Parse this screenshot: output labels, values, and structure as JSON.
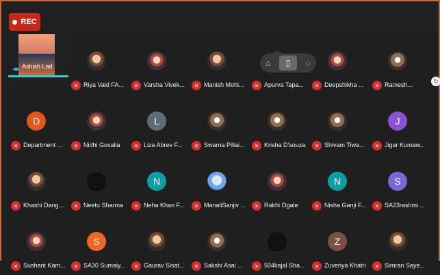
{
  "recording": {
    "label": "REC"
  },
  "participants": [
    {
      "name": "Ashish Lad",
      "avatar": "",
      "type": "video",
      "color": "#2c2c2c"
    },
    {
      "name": "Riya Vaid FA...",
      "avatar": "",
      "type": "photo",
      "color": "#8a6b55"
    },
    {
      "name": "Varsha Vivek...",
      "avatar": "",
      "type": "photo2",
      "color": "#9a4a4a"
    },
    {
      "name": "Manish Mohi...",
      "avatar": "",
      "type": "photo",
      "color": "#6c7a8a"
    },
    {
      "name": "Apurva Tapa...",
      "avatar": "",
      "type": "photo3",
      "color": "#777"
    },
    {
      "name": "Deepshikha ...",
      "avatar": "",
      "type": "photo2",
      "color": "#9b5a3c"
    },
    {
      "name": "Ramesh...",
      "avatar": "",
      "type": "photo3",
      "color": "#777"
    },
    {
      "name": "Department ...",
      "avatar": "D",
      "type": "letter",
      "color": "#e0581f"
    },
    {
      "name": "Nidhi Gosalia",
      "avatar": "",
      "type": "photo2",
      "color": "#a34545"
    },
    {
      "name": "Liza Abrev F...",
      "avatar": "L",
      "type": "letter",
      "color": "#5b6d78"
    },
    {
      "name": "Swarna Pillai...",
      "avatar": "",
      "type": "photo3",
      "color": "#777"
    },
    {
      "name": "Krisha D'souza",
      "avatar": "",
      "type": "photo3",
      "color": "#777"
    },
    {
      "name": "Shivam Tiwa...",
      "avatar": "",
      "type": "photo3",
      "color": "#777"
    },
    {
      "name": "Jigar Kumaw...",
      "avatar": "J",
      "type": "letter",
      "color": "#8b52d6"
    },
    {
      "name": "Khashi Dang...",
      "avatar": "",
      "type": "photo",
      "color": "#8a6b55"
    },
    {
      "name": "Neetu Sharma",
      "avatar": "",
      "type": "photo5",
      "color": "#111"
    },
    {
      "name": "Neha Khan F...",
      "avatar": "N",
      "type": "letter",
      "color": "#0f9ea5"
    },
    {
      "name": "ManaliSanjiv ...",
      "avatar": "",
      "type": "photo4",
      "color": "#4c7fd1"
    },
    {
      "name": "Rakhi Ogale",
      "avatar": "",
      "type": "photo2",
      "color": "#7c4a5a"
    },
    {
      "name": "Nisha Ganji F...",
      "avatar": "N",
      "type": "letter",
      "color": "#0f9ea5"
    },
    {
      "name": "SA23rashmi ...",
      "avatar": "S",
      "type": "letter",
      "color": "#7b67d8"
    },
    {
      "name": "Sushant Kam...",
      "avatar": "",
      "type": "photo2",
      "color": "#a33"
    },
    {
      "name": "SA30 Sumaiy...",
      "avatar": "S",
      "type": "letter",
      "color": "#f06724"
    },
    {
      "name": "Gaurav Sisat...",
      "avatar": "",
      "type": "photo",
      "color": "#2f3a2f"
    },
    {
      "name": "Sakshi Asai ...",
      "avatar": "",
      "type": "photo3",
      "color": "#777"
    },
    {
      "name": "504kajal Sha...",
      "avatar": "",
      "type": "photo5",
      "color": "#111"
    },
    {
      "name": "Zuveriya Khatri",
      "avatar": "Z",
      "type": "letter",
      "color": "#7b5142"
    },
    {
      "name": "Simran Saye...",
      "avatar": "",
      "type": "photo",
      "color": "#666"
    }
  ]
}
